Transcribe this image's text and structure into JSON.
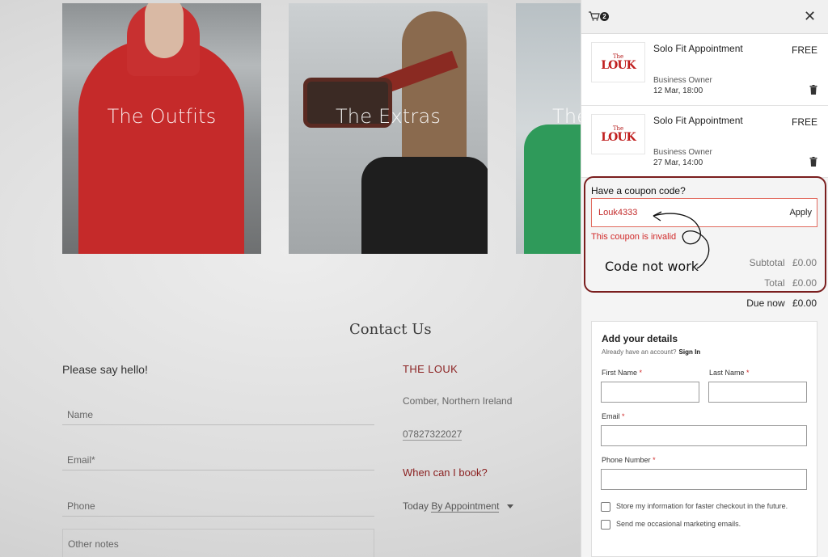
{
  "background": {
    "cards": [
      {
        "label": "The Outfits"
      },
      {
        "label": "The Extras"
      },
      {
        "label": "The"
      }
    ],
    "contact_title": "Contact Us",
    "say_hello": "Please say hello!",
    "form": {
      "name_placeholder": "Name",
      "email_placeholder": "Email*",
      "phone_placeholder": "Phone",
      "notes_placeholder": "Other notes"
    },
    "info": {
      "business_name": "THE LOUK",
      "address": "Comber, Northern Ireland",
      "phone": "07827322027",
      "when_heading": "When can I book?",
      "today_label": "Today",
      "availability": "By Appointment"
    }
  },
  "cart": {
    "item_count": "2",
    "close_icon": "close-icon",
    "logo": {
      "top": "The",
      "main": "LOUK"
    },
    "items": [
      {
        "name": "Solo Fit Appointment",
        "price": "FREE",
        "owner": "Business Owner",
        "date": "12 Mar, 18:00"
      },
      {
        "name": "Solo Fit Appointment",
        "price": "FREE",
        "owner": "Business Owner",
        "date": "27 Mar, 14:00"
      }
    ],
    "coupon": {
      "label": "Have a coupon code?",
      "value": "Louk4333",
      "apply_label": "Apply",
      "error": "This coupon is invalid"
    },
    "subtotal_label": "Subtotal",
    "subtotal_value": "£0.00",
    "total_label": "Total",
    "total_value": "£0.00",
    "due_now_label": "Due now",
    "due_now_value": "£0.00",
    "details": {
      "heading": "Add your details",
      "account_prompt": "Already have an account?",
      "sign_in": "Sign In",
      "first_name_label": "First Name",
      "last_name_label": "Last Name",
      "email_label": "Email",
      "phone_label": "Phone Number",
      "required_mark": "*",
      "store_info_label": "Store my information for faster checkout in the future.",
      "marketing_label": "Send me occasional marketing emails."
    }
  },
  "annotation": {
    "text": "Code not work",
    "color": "#7a1e1e"
  }
}
